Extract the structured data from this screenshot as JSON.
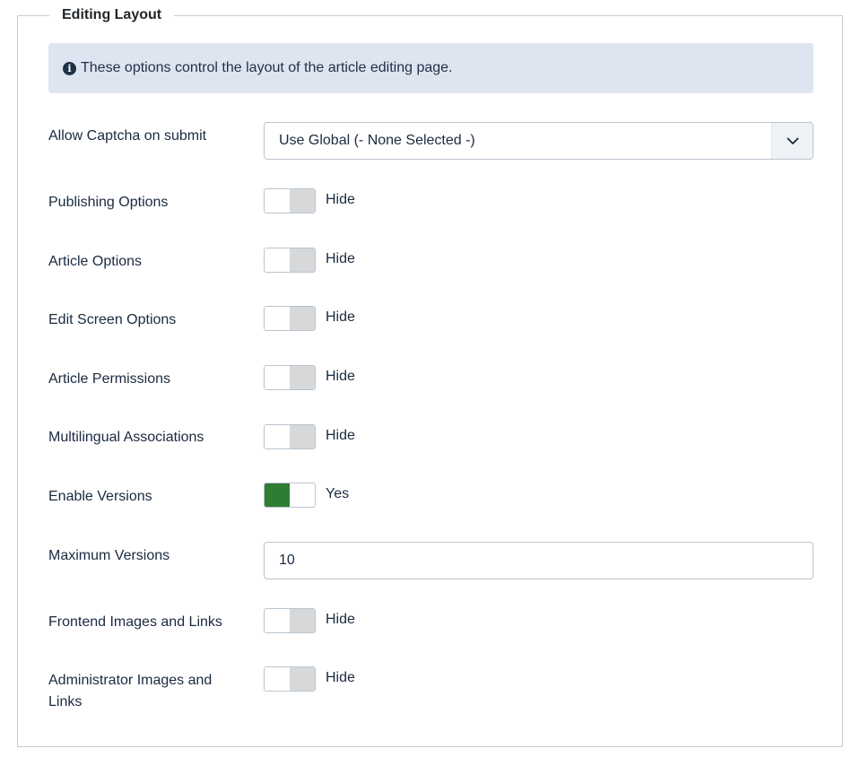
{
  "fieldset": {
    "legend": "Editing Layout",
    "alert_text": "These options control the layout of the article editing page."
  },
  "captcha": {
    "label": "Allow Captcha on submit",
    "selected": "Use Global (- None Selected -)"
  },
  "toggles": [
    {
      "label": "Publishing Options",
      "state": "Hide",
      "on": false
    },
    {
      "label": "Article Options",
      "state": "Hide",
      "on": false
    },
    {
      "label": "Edit Screen Options",
      "state": "Hide",
      "on": false
    },
    {
      "label": "Article Permissions",
      "state": "Hide",
      "on": false
    },
    {
      "label": "Multilingual Associations",
      "state": "Hide",
      "on": false
    },
    {
      "label": "Enable Versions",
      "state": "Yes",
      "on": true
    }
  ],
  "max_versions": {
    "label": "Maximum Versions",
    "value": "10"
  },
  "toggles2": [
    {
      "label": "Frontend Images and Links",
      "state": "Hide",
      "on": false
    },
    {
      "label": "Administrator Images and Links",
      "state": "Hide",
      "on": false
    }
  ],
  "colors": {
    "toggle_on": "#2f7d32",
    "toggle_off": "#d6d8da",
    "alert_bg": "#dfe5f0"
  },
  "icons": {
    "alert": "info-icon",
    "select": "chevron-down-icon"
  }
}
